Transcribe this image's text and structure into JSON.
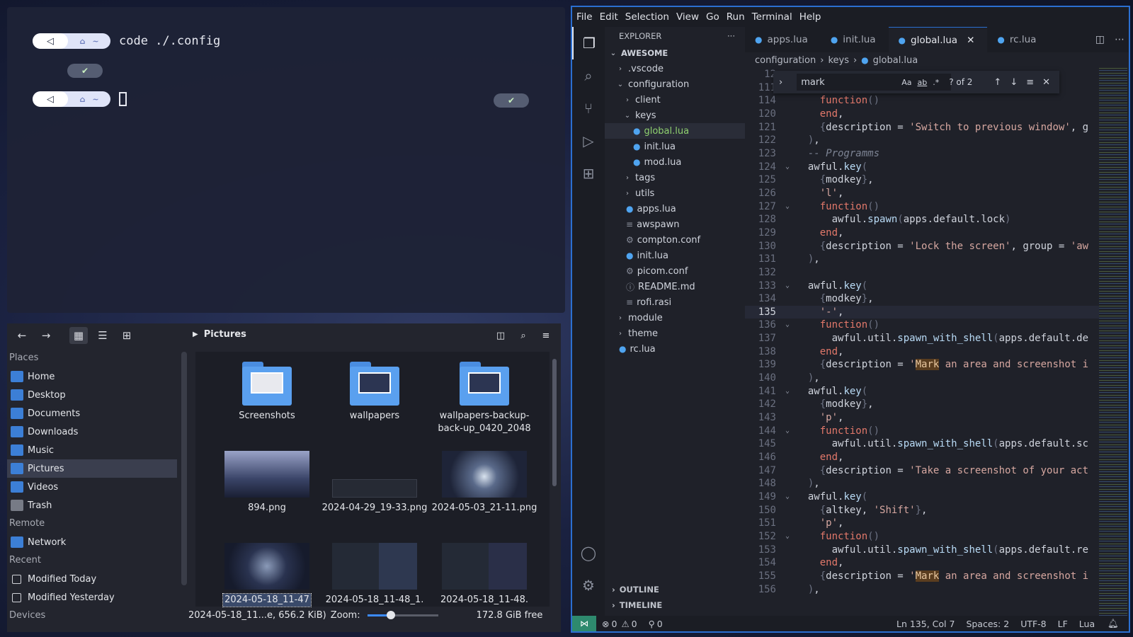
{
  "terminal": {
    "prompt_home": "~",
    "command": "code ./.config",
    "check": "✔"
  },
  "files": {
    "location": "Pictures",
    "sections": {
      "places": "Places",
      "remote": "Remote",
      "recent": "Recent",
      "devices": "Devices"
    },
    "places": [
      "Home",
      "Desktop",
      "Documents",
      "Downloads",
      "Music",
      "Pictures",
      "Videos",
      "Trash"
    ],
    "remote_items": [
      "Network"
    ],
    "recent_items": [
      "Modified Today",
      "Modified Yesterday"
    ],
    "items": [
      {
        "name": "Screenshots",
        "kind": "folder"
      },
      {
        "name": "wallpapers",
        "kind": "folder"
      },
      {
        "name": "wallpapers-backup-back-up_0420_2048",
        "kind": "folder"
      },
      {
        "name": "894.png",
        "kind": "image"
      },
      {
        "name": "2024-04-29_19-33.png",
        "kind": "image"
      },
      {
        "name": "2024-05-03_21-11.png",
        "kind": "image"
      },
      {
        "name": "2024-05-18_11-47",
        "kind": "image"
      },
      {
        "name": "2024-05-18_11-48_1.",
        "kind": "image"
      },
      {
        "name": "2024-05-18_11-48.",
        "kind": "image"
      }
    ],
    "status_selection": "2024-05-18_11...e, 656.2 KiB)",
    "zoom_label": "Zoom:",
    "zoom_level": 0.33,
    "free_space": "172.8 GiB free"
  },
  "vscode": {
    "menu": [
      "File",
      "Edit",
      "Selection",
      "View",
      "Go",
      "Run",
      "Terminal",
      "Help"
    ],
    "explorer_title": "EXPLORER",
    "explorer_more": "···",
    "root": "AWESOME",
    "tree": [
      {
        "label": ".vscode",
        "depth": 1,
        "type": "folder-closed"
      },
      {
        "label": "configuration",
        "depth": 1,
        "type": "folder-open"
      },
      {
        "label": "client",
        "depth": 2,
        "type": "folder-closed"
      },
      {
        "label": "keys",
        "depth": 2,
        "type": "folder-open"
      },
      {
        "label": "global.lua",
        "depth": 3,
        "type": "lua",
        "selected": true
      },
      {
        "label": "init.lua",
        "depth": 3,
        "type": "lua"
      },
      {
        "label": "mod.lua",
        "depth": 3,
        "type": "lua"
      },
      {
        "label": "tags",
        "depth": 2,
        "type": "folder-closed"
      },
      {
        "label": "utils",
        "depth": 2,
        "type": "folder-closed"
      },
      {
        "label": "apps.lua",
        "depth": 2,
        "type": "lua"
      },
      {
        "label": "awspawn",
        "depth": 2,
        "type": "text"
      },
      {
        "label": "compton.conf",
        "depth": 2,
        "type": "conf"
      },
      {
        "label": "init.lua",
        "depth": 2,
        "type": "lua"
      },
      {
        "label": "picom.conf",
        "depth": 2,
        "type": "conf"
      },
      {
        "label": "README.md",
        "depth": 2,
        "type": "info"
      },
      {
        "label": "rofi.rasi",
        "depth": 2,
        "type": "text"
      },
      {
        "label": "module",
        "depth": 1,
        "type": "folder-closed"
      },
      {
        "label": "theme",
        "depth": 1,
        "type": "folder-closed"
      },
      {
        "label": "rc.lua",
        "depth": 1,
        "type": "lua"
      }
    ],
    "outline": "OUTLINE",
    "timeline": "TIMELINE",
    "tabs": [
      "apps.lua",
      "init.lua",
      "global.lua",
      "rc.lua"
    ],
    "active_tab": "global.lua",
    "breadcrumbs": [
      "configuration",
      "keys",
      "global.lua"
    ],
    "find": {
      "query": "mark",
      "opt_case": "Aa",
      "opt_word": "ab",
      "opt_regex": ".*",
      "result": "? of 2"
    },
    "code_lines": [
      {
        "n": "12",
        "fold": "",
        "html": ""
      },
      {
        "n": "111",
        "fold": "",
        "html": ""
      },
      {
        "n": "114",
        "fold": "",
        "html": "    <span class='kw'>function</span><span class='br'>()</span>"
      },
      {
        "n": "120",
        "fold": "",
        "html": "    <span class='kw'>end</span>,"
      },
      {
        "n": "121",
        "fold": "",
        "html": "    <span class='br'>{</span>description = <span class='str'>'Switch to previous window'</span>, g"
      },
      {
        "n": "122",
        "fold": "",
        "html": "  <span class='br'>)</span>,"
      },
      {
        "n": "123",
        "fold": "",
        "html": "  <span class='cm'>-- Programms</span>"
      },
      {
        "n": "124",
        "fold": "⌄",
        "html": "  awful.<span class='fn'>key</span><span class='br'>(</span>"
      },
      {
        "n": "125",
        "fold": "",
        "html": "    <span class='br'>{</span>modkey<span class='br'>}</span>,"
      },
      {
        "n": "126",
        "fold": "",
        "html": "    <span class='str'>'l'</span>,"
      },
      {
        "n": "127",
        "fold": "⌄",
        "html": "    <span class='kw'>function</span><span class='br'>()</span>"
      },
      {
        "n": "128",
        "fold": "",
        "html": "      awful.<span class='fn'>spawn</span><span class='br'>(</span>apps.default.lock<span class='br'>)</span>"
      },
      {
        "n": "129",
        "fold": "",
        "html": "    <span class='kw'>end</span>,"
      },
      {
        "n": "130",
        "fold": "",
        "html": "    <span class='br'>{</span>description = <span class='str'>'Lock the screen'</span>, group = <span class='str'>'aw</span>"
      },
      {
        "n": "131",
        "fold": "",
        "html": "  <span class='br'>)</span>,"
      },
      {
        "n": "132",
        "fold": "",
        "html": ""
      },
      {
        "n": "133",
        "fold": "⌄",
        "html": "  awful.<span class='fn'>key</span><span class='br'>(</span>"
      },
      {
        "n": "134",
        "fold": "",
        "html": "    <span class='br'>{</span>modkey<span class='br'>}</span>,"
      },
      {
        "n": "135",
        "fold": "",
        "html": "    <span class='str'>'-'</span>,",
        "cur": true
      },
      {
        "n": "136",
        "fold": "⌄",
        "html": "    <span class='kw'>function</span><span class='br'>()</span>"
      },
      {
        "n": "137",
        "fold": "",
        "html": "      awful.util.<span class='fn'>spawn_with_shell</span><span class='br'>(</span>apps.default.de"
      },
      {
        "n": "138",
        "fold": "",
        "html": "    <span class='kw'>end</span>,"
      },
      {
        "n": "139",
        "fold": "",
        "html": "    <span class='br'>{</span>description = <span class='str'>'<span class=\"hl\">Mark</span> an area and screenshot i</span>"
      },
      {
        "n": "140",
        "fold": "",
        "html": "  <span class='br'>)</span>,"
      },
      {
        "n": "141",
        "fold": "⌄",
        "html": "  awful.<span class='fn'>key</span><span class='br'>(</span>"
      },
      {
        "n": "142",
        "fold": "",
        "html": "    <span class='br'>{</span>modkey<span class='br'>}</span>,"
      },
      {
        "n": "143",
        "fold": "",
        "html": "    <span class='str'>'p'</span>,"
      },
      {
        "n": "144",
        "fold": "⌄",
        "html": "    <span class='kw'>function</span><span class='br'>()</span>"
      },
      {
        "n": "145",
        "fold": "",
        "html": "      awful.util.<span class='fn'>spawn_with_shell</span><span class='br'>(</span>apps.default.sc"
      },
      {
        "n": "146",
        "fold": "",
        "html": "    <span class='kw'>end</span>,"
      },
      {
        "n": "147",
        "fold": "",
        "html": "    <span class='br'>{</span>description = <span class='str'>'Take a screenshot of your act</span>"
      },
      {
        "n": "148",
        "fold": "",
        "html": "  <span class='br'>)</span>,"
      },
      {
        "n": "149",
        "fold": "⌄",
        "html": "  awful.<span class='fn'>key</span><span class='br'>(</span>"
      },
      {
        "n": "150",
        "fold": "",
        "html": "    <span class='br'>{</span>altkey, <span class='str'>'Shift'</span><span class='br'>}</span>,"
      },
      {
        "n": "151",
        "fold": "",
        "html": "    <span class='str'>'p'</span>,"
      },
      {
        "n": "152",
        "fold": "⌄",
        "html": "    <span class='kw'>function</span><span class='br'>()</span>"
      },
      {
        "n": "153",
        "fold": "",
        "html": "      awful.util.<span class='fn'>spawn_with_shell</span><span class='br'>(</span>apps.default.re"
      },
      {
        "n": "154",
        "fold": "",
        "html": "    <span class='kw'>end</span>,"
      },
      {
        "n": "155",
        "fold": "",
        "html": "    <span class='br'>{</span>description = <span class='str'>'<span class=\"hl\">Mark</span> an area and screenshot i</span>"
      },
      {
        "n": "156",
        "fold": "",
        "html": "  <span class='br'>)</span>,"
      }
    ],
    "status": {
      "errors": "0",
      "warnings": "0",
      "ports": "0",
      "position": "Ln 135, Col 7",
      "spaces": "Spaces: 2",
      "encoding": "UTF-8",
      "eol": "LF",
      "language": "Lua"
    }
  }
}
